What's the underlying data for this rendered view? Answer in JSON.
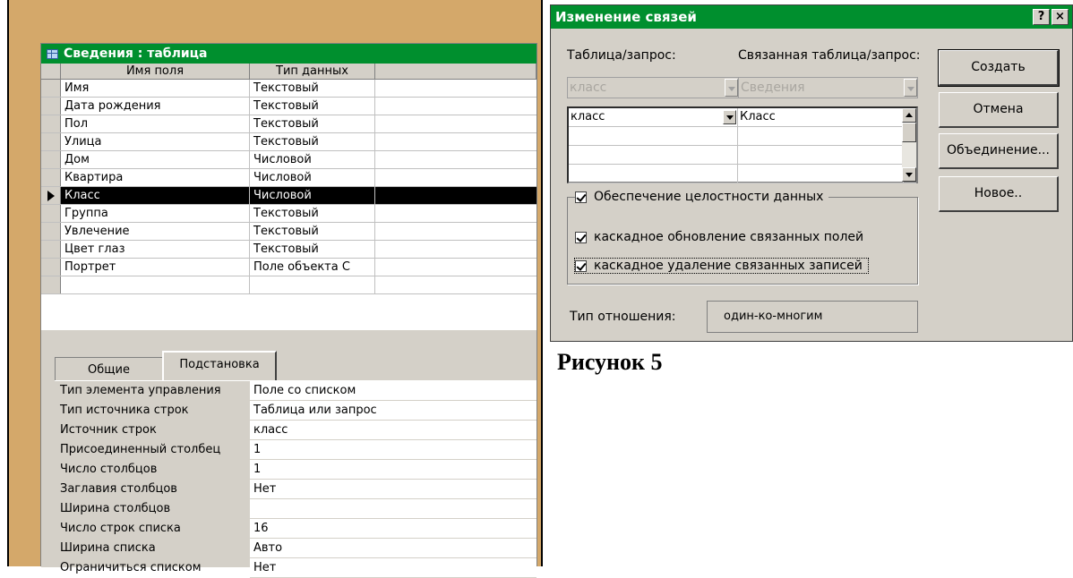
{
  "design_window": {
    "title": "Сведения : таблица",
    "columns": {
      "name": "Имя поля",
      "type": "Тип данных"
    },
    "rows": [
      {
        "name": "Имя",
        "type": "Текстовый"
      },
      {
        "name": "Дата рождения",
        "type": "Текстовый"
      },
      {
        "name": "Пол",
        "type": "Текстовый"
      },
      {
        "name": "Улица",
        "type": "Текстовый"
      },
      {
        "name": "Дом",
        "type": "Числовой"
      },
      {
        "name": "Квартира",
        "type": "Числовой"
      },
      {
        "name": "Класс",
        "type": "Числовой"
      },
      {
        "name": "Группа",
        "type": "Текстовый"
      },
      {
        "name": "Увлечение",
        "type": "Текстовый"
      },
      {
        "name": "Цвет глаз",
        "type": "Текстовый"
      },
      {
        "name": "Портрет",
        "type": "Поле объекта С"
      }
    ],
    "active_row": 6,
    "tabs": {
      "general": "Общие",
      "lookup": "Подстановка"
    },
    "properties": [
      {
        "label": "Тип элемента управления",
        "value": "Поле со списком"
      },
      {
        "label": "Тип источника строк",
        "value": "Таблица или запрос"
      },
      {
        "label": "Источник строк",
        "value": "класс"
      },
      {
        "label": "Присоединенный столбец",
        "value": "1"
      },
      {
        "label": "Число столбцов",
        "value": "1"
      },
      {
        "label": "Заглавия столбцов",
        "value": "Нет"
      },
      {
        "label": "Ширина столбцов",
        "value": ""
      },
      {
        "label": "Число строк списка",
        "value": "16"
      },
      {
        "label": "Ширина списка",
        "value": "Авто"
      },
      {
        "label": "Ограничиться списком",
        "value": "Нет"
      }
    ]
  },
  "dialog": {
    "title": "Изменение связей",
    "help_glyph": "?",
    "close_glyph": "×",
    "table_label": "Таблица/запрос:",
    "related_label": "Связанная таблица/запрос:",
    "table_value": "класс",
    "related_value": "Сведения",
    "field_rows": [
      {
        "a": "класс",
        "b": "Класс"
      },
      {
        "a": "",
        "b": ""
      },
      {
        "a": "",
        "b": ""
      },
      {
        "a": "",
        "b": ""
      }
    ],
    "checkboxes": {
      "integrity": "Обеспечение целостности данных",
      "cascade_update": "каскадное обновление связанных полей",
      "cascade_delete": "каскадное удаление связанных записей"
    },
    "relation_type_label": "Тип отношения:",
    "relation_type_value": "один-ко-многим",
    "buttons": {
      "create": "Создать",
      "cancel": "Отмена",
      "join": "Объединение...",
      "new": "Новое.."
    }
  },
  "caption": "Рисунок 5"
}
